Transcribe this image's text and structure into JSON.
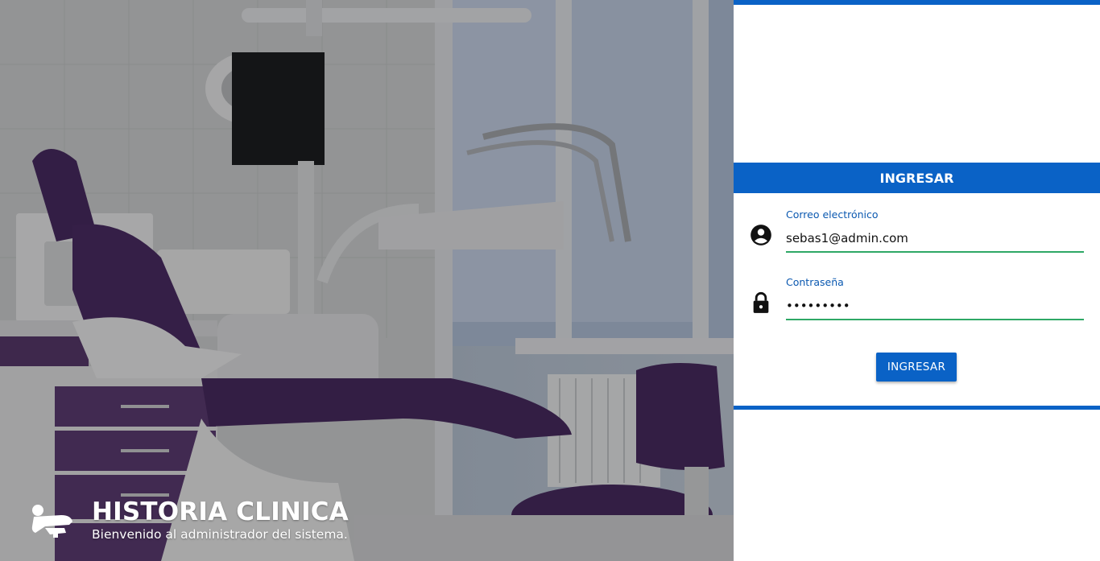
{
  "brand": {
    "title": "HISTORIA CLINICA",
    "subtitle": "Bienvenido al administrador del sistema.",
    "logo_icon": "dental-chair-icon"
  },
  "login": {
    "header": "INGRESAR",
    "email": {
      "label": "Correo electrónico",
      "value": "sebas1@admin.com",
      "icon": "account-circle-icon"
    },
    "password": {
      "label": "Contraseña",
      "value": "sebas1234",
      "icon": "lock-icon"
    },
    "submit_label": "INGRESAR"
  },
  "colors": {
    "primary": "#0a62c6",
    "input_underline": "#2ea866",
    "label": "#0a58b0"
  }
}
